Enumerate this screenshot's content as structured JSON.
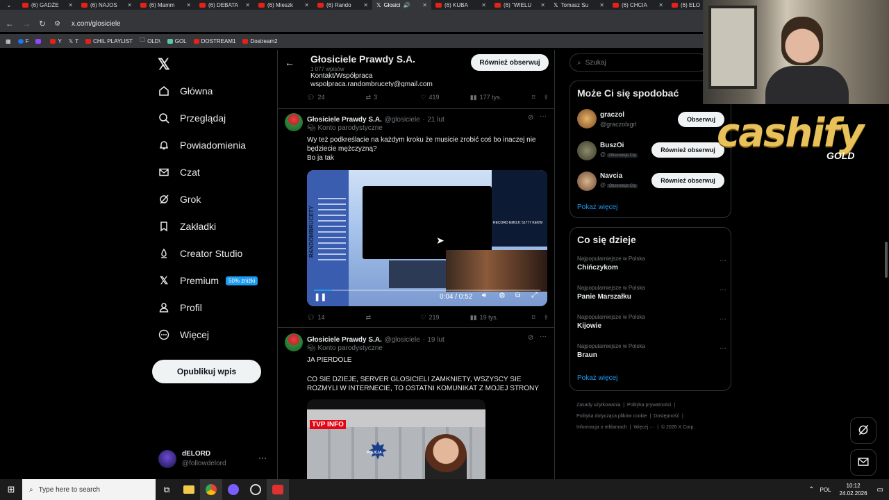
{
  "browser": {
    "tabs": [
      "(6) GADŻE",
      "(6) NAJOS",
      "(6) Mamm",
      "(6) DEBATA",
      "(6) Mieszk",
      "(6) Rando",
      "Głosici",
      "(6) KUBA",
      "(6) \"WIELU",
      "Tomasz Su",
      "(6) CHCIA",
      "(6) ELO"
    ],
    "active_tab_index": 6,
    "url": "x.com/glosiciele",
    "bookmarks": [
      "F",
      "",
      "Y",
      "T",
      "CHIL PLAYLIST",
      "OLD\\",
      "GOL",
      "DOSTREAM1",
      "Dostream2"
    ]
  },
  "left_nav": {
    "items": [
      "Główna",
      "Przeglądaj",
      "Powiadomienia",
      "Czat",
      "Grok",
      "Zakładki",
      "Creator Studio",
      "Premium",
      "Profil",
      "Więcej"
    ],
    "premium_badge": "50% zniżki",
    "post_button": "Opublikuj wpis",
    "account": {
      "name": "dELORD",
      "handle": "@followdelord"
    }
  },
  "profile_header": {
    "name": "Głosiciele Prawdy S.A.",
    "posts": "1 077 wpisów",
    "follow_back": "Również obserwuj",
    "bio_partial_1": "Kontakt/Współpraca",
    "bio_partial_2": "wspolpraca.randombrucety@gmail.com"
  },
  "tweet0_actions": {
    "replies": "24",
    "reposts": "3",
    "likes": "419",
    "views": "177 tys."
  },
  "tweet1": {
    "name": "Głosiciele Prawdy S.A.",
    "handle": "@glosiciele",
    "date": "21 lut",
    "label": "Konto parodystyczne",
    "text_1": "Wy też podkreślacie na każdym kroku że musicie zrobić coś bo inaczej nie będziecie mężczyzną?",
    "text_2": "Bo ja tak",
    "video_time": "0:04 / 0:52",
    "video_overlay": "RECORD EMOJI: 51777 KEKW",
    "video_side_text": "RANDOMBRUCETY",
    "replies": "14",
    "reposts": "",
    "likes": "219",
    "views": "19 tys."
  },
  "tweet2": {
    "name": "Głosiciele Prawdy S.A.",
    "handle": "@glosiciele",
    "date": "19 lut",
    "label": "Konto parodystyczne",
    "text_1": "JA PIERDOLE",
    "text_2": "CO SIE DZIEJE, SERVER GLOSICIELI ZAMKNIETY, WSZYSCY SIE ROZMYLI W INTERNECIE, TO OSTATNI KOMUNIKAT Z MOJEJ STRONY",
    "image_logo": "TVP INFO",
    "image_badge": "POLICJA"
  },
  "search": {
    "placeholder": "Szukaj"
  },
  "suggestions": {
    "title": "Może Ci się spodobać",
    "users": [
      {
        "name": "graczol",
        "handle": "@graczolxgrl",
        "button": "Obserwuj",
        "follows_you": ""
      },
      {
        "name": "BuszOi",
        "handle": "@",
        "button": "Również obserwuj",
        "follows_you": "Obserwuje Cię"
      },
      {
        "name": "Navcia",
        "handle": "@",
        "button": "Również obserwuj",
        "follows_you": "Obserwuje Cię"
      }
    ],
    "more": "Pokaż więcej"
  },
  "trends": {
    "title": "Co się dzieje",
    "items": [
      {
        "category": "Najpopularniejsze w Polska",
        "name": "Chińczykom"
      },
      {
        "category": "Najpopularniejsze w Polska",
        "name": "Panie Marszałku"
      },
      {
        "category": "Najpopularniejsze w Polska",
        "name": "Kijowie"
      },
      {
        "category": "Najpopularniejsze w Polska",
        "name": "Braun"
      }
    ],
    "more": "Pokaż więcej"
  },
  "footer": {
    "links": [
      "Zasady użytkowania",
      "Polityka prywatności",
      "Polityka dotycząca plików cookie",
      "Dostępność",
      "Informacja o reklamach",
      "Więcej ···",
      "© 2026 X Corp."
    ]
  },
  "overlay": {
    "brand": "cashify",
    "brand_sub": "GOLD"
  },
  "taskbar": {
    "search": "Type here to search",
    "lang": "POL",
    "time": "10:12",
    "date": "24.02.2026"
  },
  "colors": {
    "accent": "#1d9bf0",
    "bg": "#000000",
    "text": "#e7e9ea",
    "muted": "#71767b",
    "brand_gold": "#e8c15a"
  }
}
